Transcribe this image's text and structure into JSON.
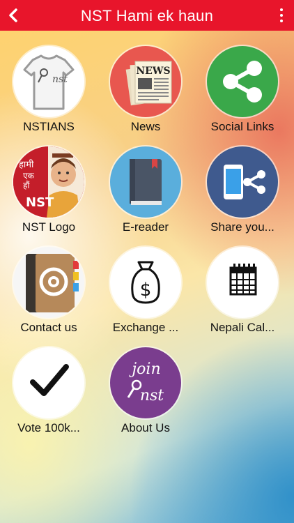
{
  "header": {
    "title": "NST Hami ek haun",
    "back_icon": "back-arrow-icon",
    "menu_icon": "more-vertical-icon"
  },
  "tiles": [
    {
      "label": "NSTIANS",
      "icon": "tshirt-icon",
      "shirt_text": "nst"
    },
    {
      "label": "News",
      "icon": "newspaper-icon",
      "paper_text": "NEWS"
    },
    {
      "label": "Social Links",
      "icon": "share-icon"
    },
    {
      "label": "NST Logo",
      "icon": "nst-logo-image",
      "logo_text_1": "हामी",
      "logo_text_2": "एक",
      "logo_text_3": "हौं",
      "logo_text_4": "NST"
    },
    {
      "label": "E-reader",
      "icon": "book-icon"
    },
    {
      "label": "Share you...",
      "icon": "phone-share-icon"
    },
    {
      "label": "Contact us",
      "icon": "address-book-icon"
    },
    {
      "label": "Exchange ...",
      "icon": "money-bag-icon"
    },
    {
      "label": "Nepali Cal...",
      "icon": "calendar-icon"
    },
    {
      "label": "Vote 100k...",
      "icon": "checkmark-icon"
    },
    {
      "label": "About Us",
      "icon": "join-nst-icon",
      "join_text": "join",
      "nst_text": "nst"
    }
  ],
  "colors": {
    "header": "#e8152b",
    "news_bg": "#e8574f",
    "social_bg": "#3aa84a",
    "ereader_bg": "#5aaedc",
    "share_bg": "#3f5a8e",
    "about_bg": "#7a3d8e"
  }
}
